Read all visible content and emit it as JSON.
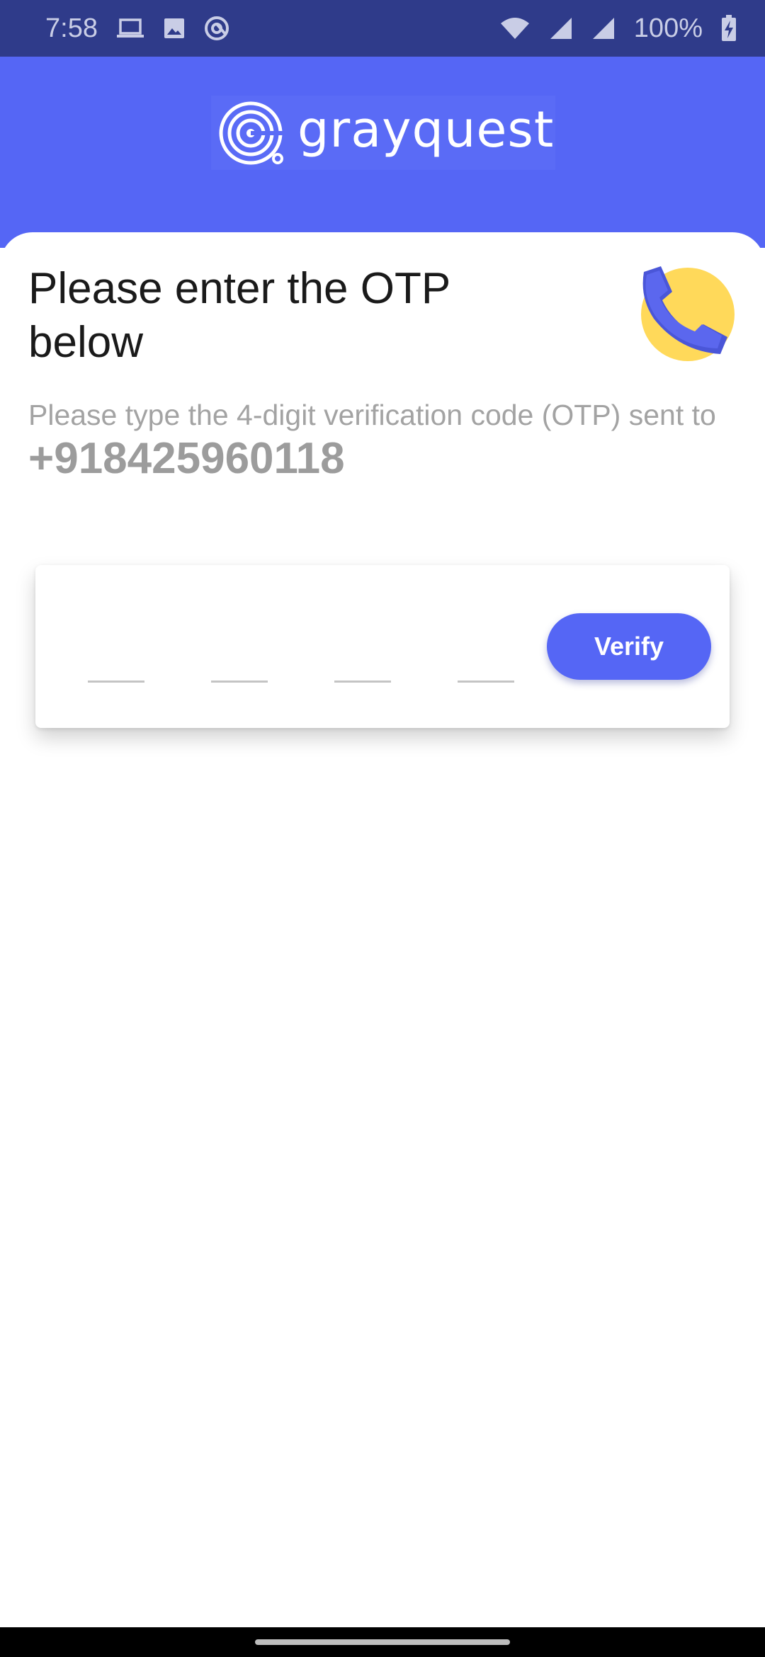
{
  "status_bar": {
    "time": "7:58",
    "battery": "100%",
    "left_icons": [
      "laptop-icon",
      "image-icon",
      "sync-icon"
    ],
    "right_icons": [
      "wifi-icon",
      "signal-icon",
      "signal-icon",
      "battery-charging-icon"
    ]
  },
  "header": {
    "brand": "grayquest",
    "background_color": "#5566f5"
  },
  "otp": {
    "title": "Please enter the OTP below",
    "subtitle": "Please type the 4-digit verification code (OTP) sent to",
    "phone": "+918425960118",
    "digit_count": 4,
    "verify_label": "Verify",
    "icon": "phone-icon"
  },
  "colors": {
    "accent": "#5566f5",
    "status_bar": "#2f3b8a",
    "badge": "#ffd95a",
    "muted_text": "#a3a3a3"
  }
}
